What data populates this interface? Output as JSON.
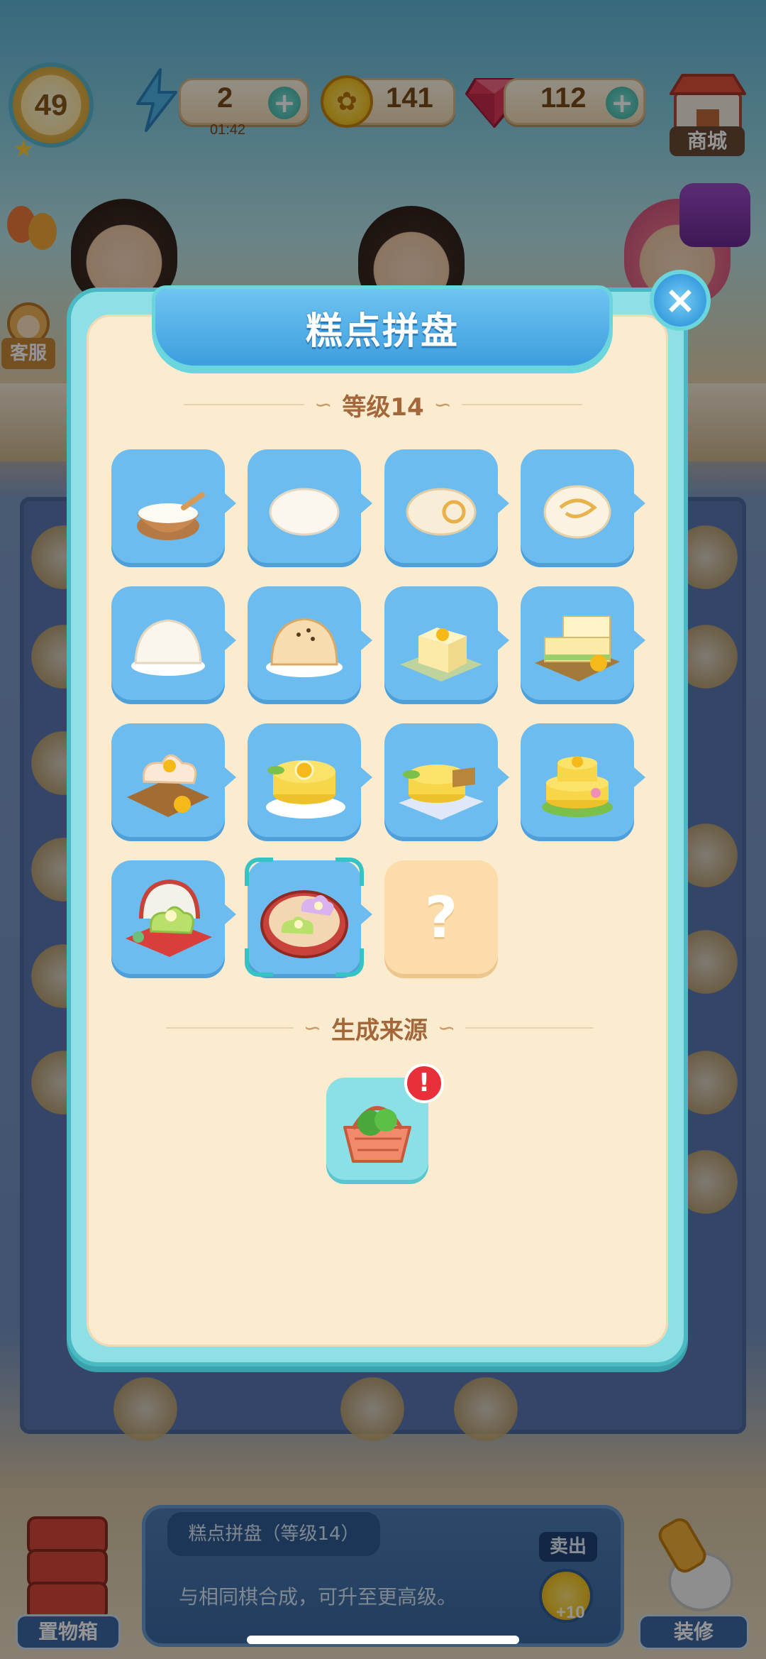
{
  "hud": {
    "level": "49",
    "energy": "2",
    "energy_timer": "01:42",
    "coins": "141",
    "gems": "112",
    "plus_label": "+",
    "shop_label": "商城",
    "service_label": "客服"
  },
  "modal": {
    "title": "糕点拼盘",
    "level_header": "等级14",
    "source_header": "生成来源",
    "close_icon": "×",
    "unknown_mark": "?",
    "alert_mark": "!",
    "items": [
      {
        "icon": "flour-bowl-icon"
      },
      {
        "icon": "dough-bun-icon"
      },
      {
        "icon": "swirl-roll-icon"
      },
      {
        "icon": "swirl-bun-icon"
      },
      {
        "icon": "steamed-bun-icon"
      },
      {
        "icon": "sesame-pastry-icon"
      },
      {
        "icon": "flower-tofu-cake-icon"
      },
      {
        "icon": "layered-flower-cake-icon"
      },
      {
        "icon": "flower-shaped-cake-icon"
      },
      {
        "icon": "orange-slice-cake-icon"
      },
      {
        "icon": "sliced-orange-cake-icon"
      },
      {
        "icon": "two-tier-orange-cake-icon"
      },
      {
        "icon": "green-flower-jelly-platter-icon"
      },
      {
        "icon": "pastry-platter-box-icon"
      },
      {
        "icon": "unknown-item-icon"
      }
    ],
    "source_icon": "vegetable-basket-icon"
  },
  "bottom": {
    "item_name": "糕点拼盘（等级14）",
    "description": "与相同棋合成，可升至更高级。",
    "sell_label": "卖出",
    "sell_value": "+10",
    "storage_label": "置物箱",
    "decor_label": "装修"
  },
  "colors": {
    "modal_frame": "#8fe0e4",
    "modal_body": "#fbecd0",
    "cell_blue": "#6cbcf0",
    "title_blue": "#3d9ede",
    "accent_brown": "#a4673a"
  }
}
